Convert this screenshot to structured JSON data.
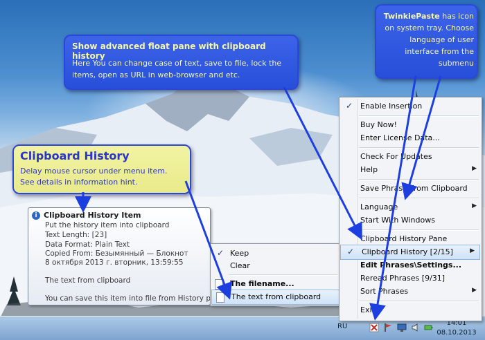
{
  "callouts": {
    "float_pane": {
      "title": "Show advanced float pane with clipboard history",
      "body": "Here You can change case of text, save to file, lock the items, open as URL in web-browser and etc."
    },
    "tray": {
      "title": "TwinkiePaste",
      "body": " has icon on system tray. Choose language of user interface from the submenu"
    },
    "history": {
      "title": "Clipboard History",
      "line1": "Delay mouse cursor under menu item.",
      "line2": "See details in information hint."
    }
  },
  "tray_menu": {
    "items": [
      {
        "label": "Enable Insertion",
        "checked": true
      },
      {
        "label": "Buy Now!"
      },
      {
        "label": "Enter License Data..."
      },
      {
        "label": "Check For Updates"
      },
      {
        "label": "Help",
        "submenu": true
      },
      {
        "label": "Save Phrase From Clipboard"
      },
      {
        "label": "Language",
        "submenu": true
      },
      {
        "label": "Start With Windows"
      },
      {
        "label": "Clipboard History Pane"
      },
      {
        "label": "Clipboard History [2/15]",
        "checked": true,
        "submenu": true,
        "highlighted": true
      },
      {
        "label": "Edit Phrases\\Settings...",
        "bold": true
      },
      {
        "label": "Reread Phrases [9/31]"
      },
      {
        "label": "Sort Phrases",
        "submenu": true
      },
      {
        "label": "Exit"
      }
    ]
  },
  "history_menu": {
    "items": [
      {
        "label": "Keep",
        "checked": true
      },
      {
        "label": "Clear"
      },
      {
        "label": "The filename...",
        "bold": true
      },
      {
        "label": "The text from clipboard",
        "highlighted": true
      }
    ]
  },
  "tooltip": {
    "title": "Clipboard History Item",
    "lines": [
      "Put the history item into clipboard",
      "Text Length: [23]",
      "Data Format: Plain Text",
      "Copied From: Безымянный — Блокнот",
      "8 октября 2013 г. вторник, 13:59:55",
      "The text from clipboard",
      "You can save this item into file from History pane"
    ]
  },
  "taskbar": {
    "language": "RU",
    "time": "14:01",
    "date": "08.10.2013"
  },
  "icons": {
    "info": "info-icon",
    "check": "checkmark-icon",
    "submenu": "submenu-arrow-icon",
    "document": "document-icon"
  },
  "colors": {
    "callout_blue": "#2f56de",
    "callout_yellow": "#eeef98",
    "arrow": "#1e3fe0"
  }
}
